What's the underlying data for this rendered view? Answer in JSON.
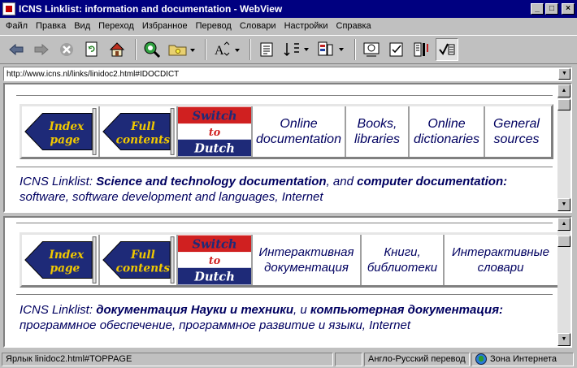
{
  "window": {
    "title": "ICNS Linklist: information and documentation - WebView",
    "buttons": {
      "minimize": "_",
      "maximize": "□",
      "close": "×"
    }
  },
  "menu": [
    "Файл",
    "Правка",
    "Вид",
    "Переход",
    "Избранное",
    "Перевод",
    "Словари",
    "Настройки",
    "Справка"
  ],
  "toolbar": {
    "icons": [
      "back-icon",
      "forward-icon",
      "stop-icon",
      "refresh-icon",
      "home-icon",
      "search-icon",
      "favorites-folder-icon",
      "font-size-icon",
      "page-icon",
      "sort-icon",
      "translate-icon",
      "preview-icon",
      "edit-icon",
      "book-icon",
      "check-translate-icon"
    ]
  },
  "address": {
    "url": "http://www.icns.nl/links/linidoc2.html#IDOCDICT"
  },
  "frame1": {
    "nav": {
      "index": [
        "Index",
        "page"
      ],
      "full": [
        "Full",
        "contents"
      ],
      "switch": [
        "Switch",
        "to",
        "Dutch"
      ],
      "links": [
        "Online documentation",
        "Books, libraries",
        "Online dictionaries",
        "General sources"
      ]
    },
    "intro": {
      "prefix": "ICNS Linklist: ",
      "bold1": "Science and technology documentation",
      "mid": ", and ",
      "bold2": "computer documentation:",
      "line2": "software, software development and languages, Internet"
    }
  },
  "frame2": {
    "nav": {
      "index": [
        "Index",
        "page"
      ],
      "full": [
        "Full",
        "contents"
      ],
      "switch": [
        "Switch",
        "to",
        "Dutch"
      ],
      "links": [
        "Интерактивная документация",
        "Книги, библиотеки",
        "Интерактивные словари"
      ]
    },
    "intro": {
      "prefix": "ICNS Linklist: ",
      "bold1": "документация Науки и техники",
      "mid": ", и ",
      "bold2": "компьютерная документация:",
      "line2": "программное обеспечение, программное развитие и языки, Internet"
    }
  },
  "status": {
    "link": "Ярлык linidoc2.html#TOPPAGE",
    "translation": "Англо-Русский перевод",
    "zone": "Зона Интернета"
  },
  "colors": {
    "titlebar": "#000080",
    "link_text": "#000060",
    "arrow_blue": "#1e2a78",
    "arrow_yellow": "#f0c800",
    "flag_red": "#d02020",
    "flag_blue": "#1e2a78"
  }
}
